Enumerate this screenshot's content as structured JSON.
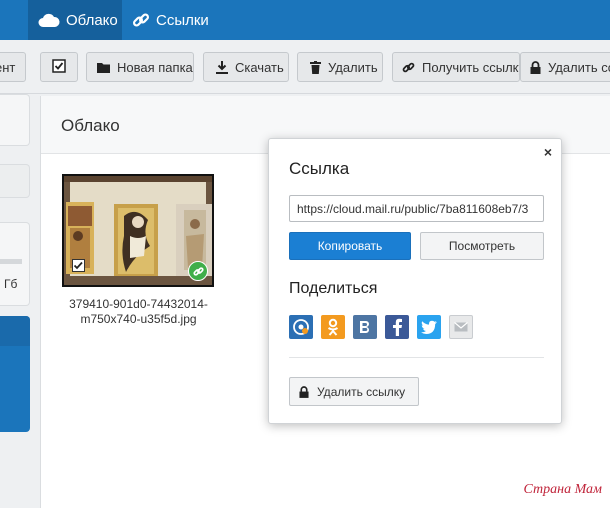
{
  "header": {
    "tabs": [
      {
        "label": "Облако",
        "icon": "cloud-icon",
        "active": true
      },
      {
        "label": "Ссылки",
        "icon": "link-icon",
        "active": false
      }
    ],
    "bg_color": "#1b75bb"
  },
  "toolbar": {
    "partial_label": "ент",
    "checkbox_icon": "checkbox-icon",
    "new_folder": "Новая папка",
    "download": "Скачать",
    "delete": "Удалить",
    "get_link": "Получить ссылку",
    "delete_link": "Удалить ссы"
  },
  "sidebar": {
    "partial_text": "Гб"
  },
  "main": {
    "title": "Облако",
    "file": {
      "name": "379410-901d0-74432014-m750x740-u35f5d.jpg",
      "name_line1": "379410-901d0-74432014-",
      "name_line2": "m750x740-u35f5d.jpg",
      "checked": true,
      "shared": true
    }
  },
  "popup": {
    "title": "Ссылка",
    "link_value": "https://cloud.mail.ru/public/7ba811608eb7/3",
    "copy_label": "Копировать",
    "view_label": "Посмотреть",
    "share_title": "Поделиться",
    "share_icons": [
      {
        "name": "mail-agent-icon",
        "color": "#2b6fb4"
      },
      {
        "name": "odnoklassniki-icon",
        "color": "#f39a1f"
      },
      {
        "name": "vkontakte-icon",
        "color": "#4d75a3"
      },
      {
        "name": "facebook-icon",
        "color": "#3b5998"
      },
      {
        "name": "twitter-icon",
        "color": "#2aa3ef"
      },
      {
        "name": "email-icon",
        "color": "#e8e9ea"
      }
    ],
    "delete_link_label": "Удалить ссылку",
    "close_label": "×"
  },
  "watermark": "Страна Мам"
}
